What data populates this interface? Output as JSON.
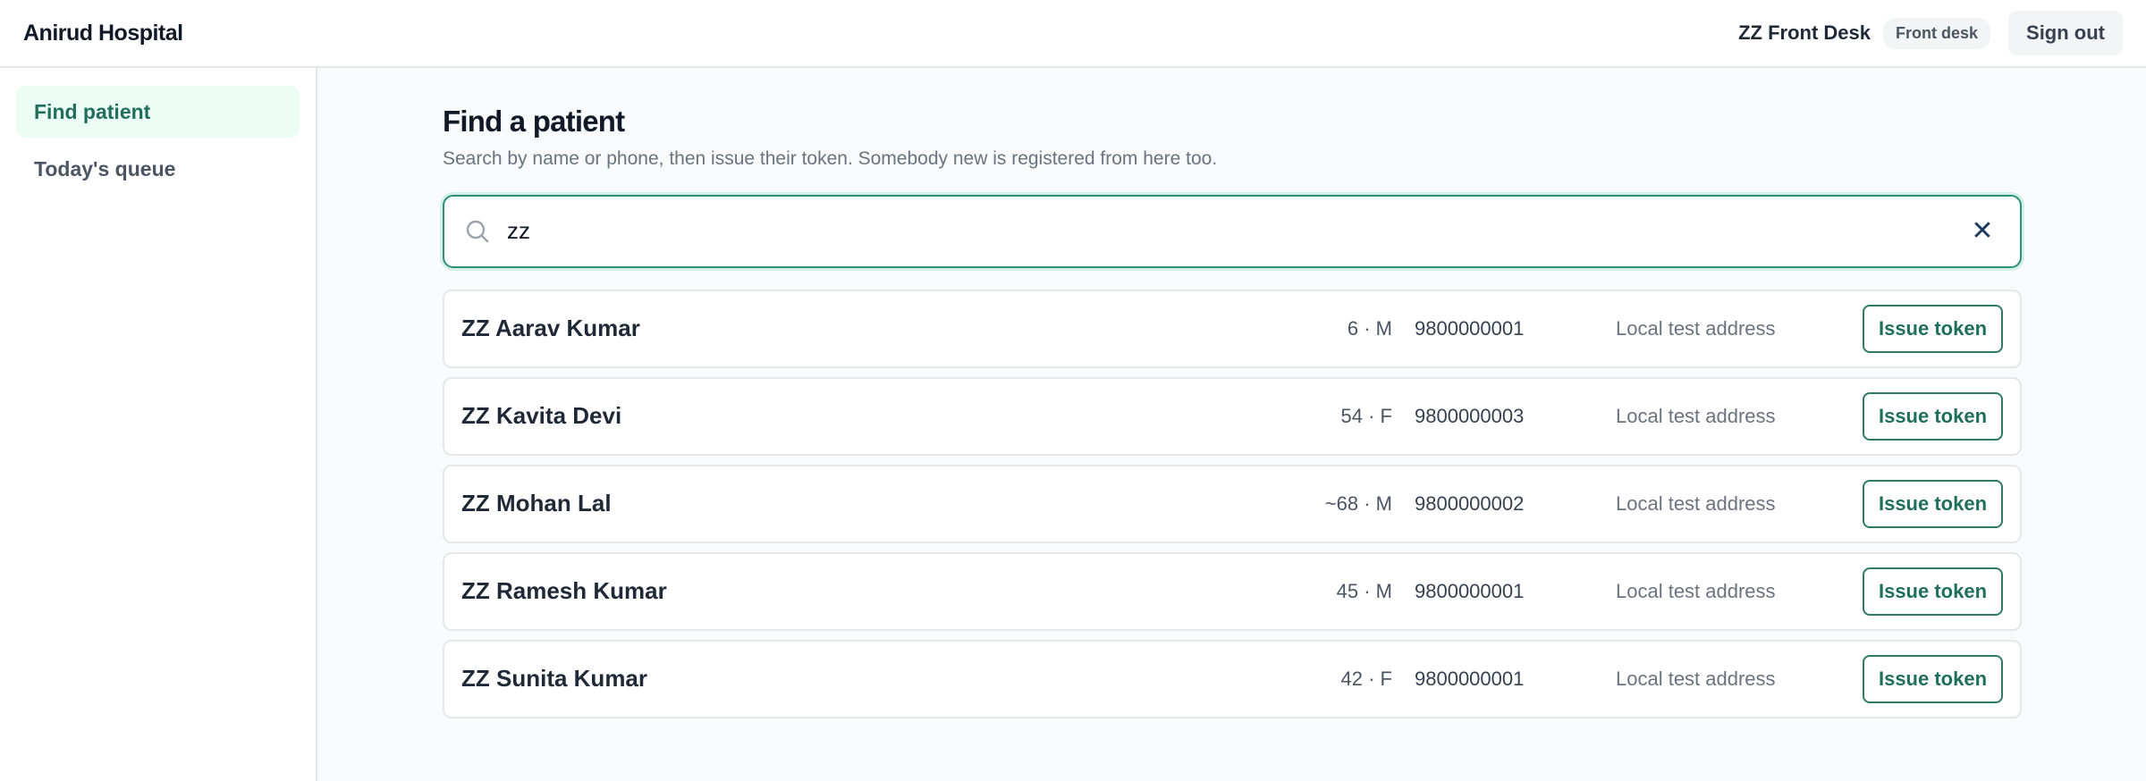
{
  "app": {
    "brand": "Anirud Hospital"
  },
  "user": {
    "name": "ZZ Front Desk",
    "role": "Front desk",
    "signout_label": "Sign out"
  },
  "sidebar": {
    "items": [
      {
        "label": "Find patient",
        "active": true
      },
      {
        "label": "Today's queue",
        "active": false
      }
    ]
  },
  "main": {
    "title": "Find a patient",
    "subtitle": "Search by name or phone, then issue their token. Somebody new is registered from here too.",
    "search": {
      "value": "zz",
      "icon": "search-icon",
      "clear_icon": "close-icon",
      "clear_glyph": "✕"
    },
    "action_label": "Issue token",
    "patients": [
      {
        "name": "ZZ Aarav Kumar",
        "age_sex": "6 · M",
        "phone": "9800000001",
        "address": "Local test address"
      },
      {
        "name": "ZZ Kavita Devi",
        "age_sex": "54 · F",
        "phone": "9800000003",
        "address": "Local test address"
      },
      {
        "name": "ZZ Mohan Lal",
        "age_sex": "~68 · M",
        "phone": "9800000002",
        "address": "Local test address"
      },
      {
        "name": "ZZ Ramesh Kumar",
        "age_sex": "45 · M",
        "phone": "9800000001",
        "address": "Local test address"
      },
      {
        "name": "ZZ Sunita Kumar",
        "age_sex": "42 · F",
        "phone": "9800000001",
        "address": "Local test address"
      }
    ]
  },
  "colors": {
    "accent": "#1f6f5c",
    "accent_border": "#2f8f78",
    "active_nav_bg": "#ecfdf5",
    "page_bg": "#f9fafb"
  }
}
